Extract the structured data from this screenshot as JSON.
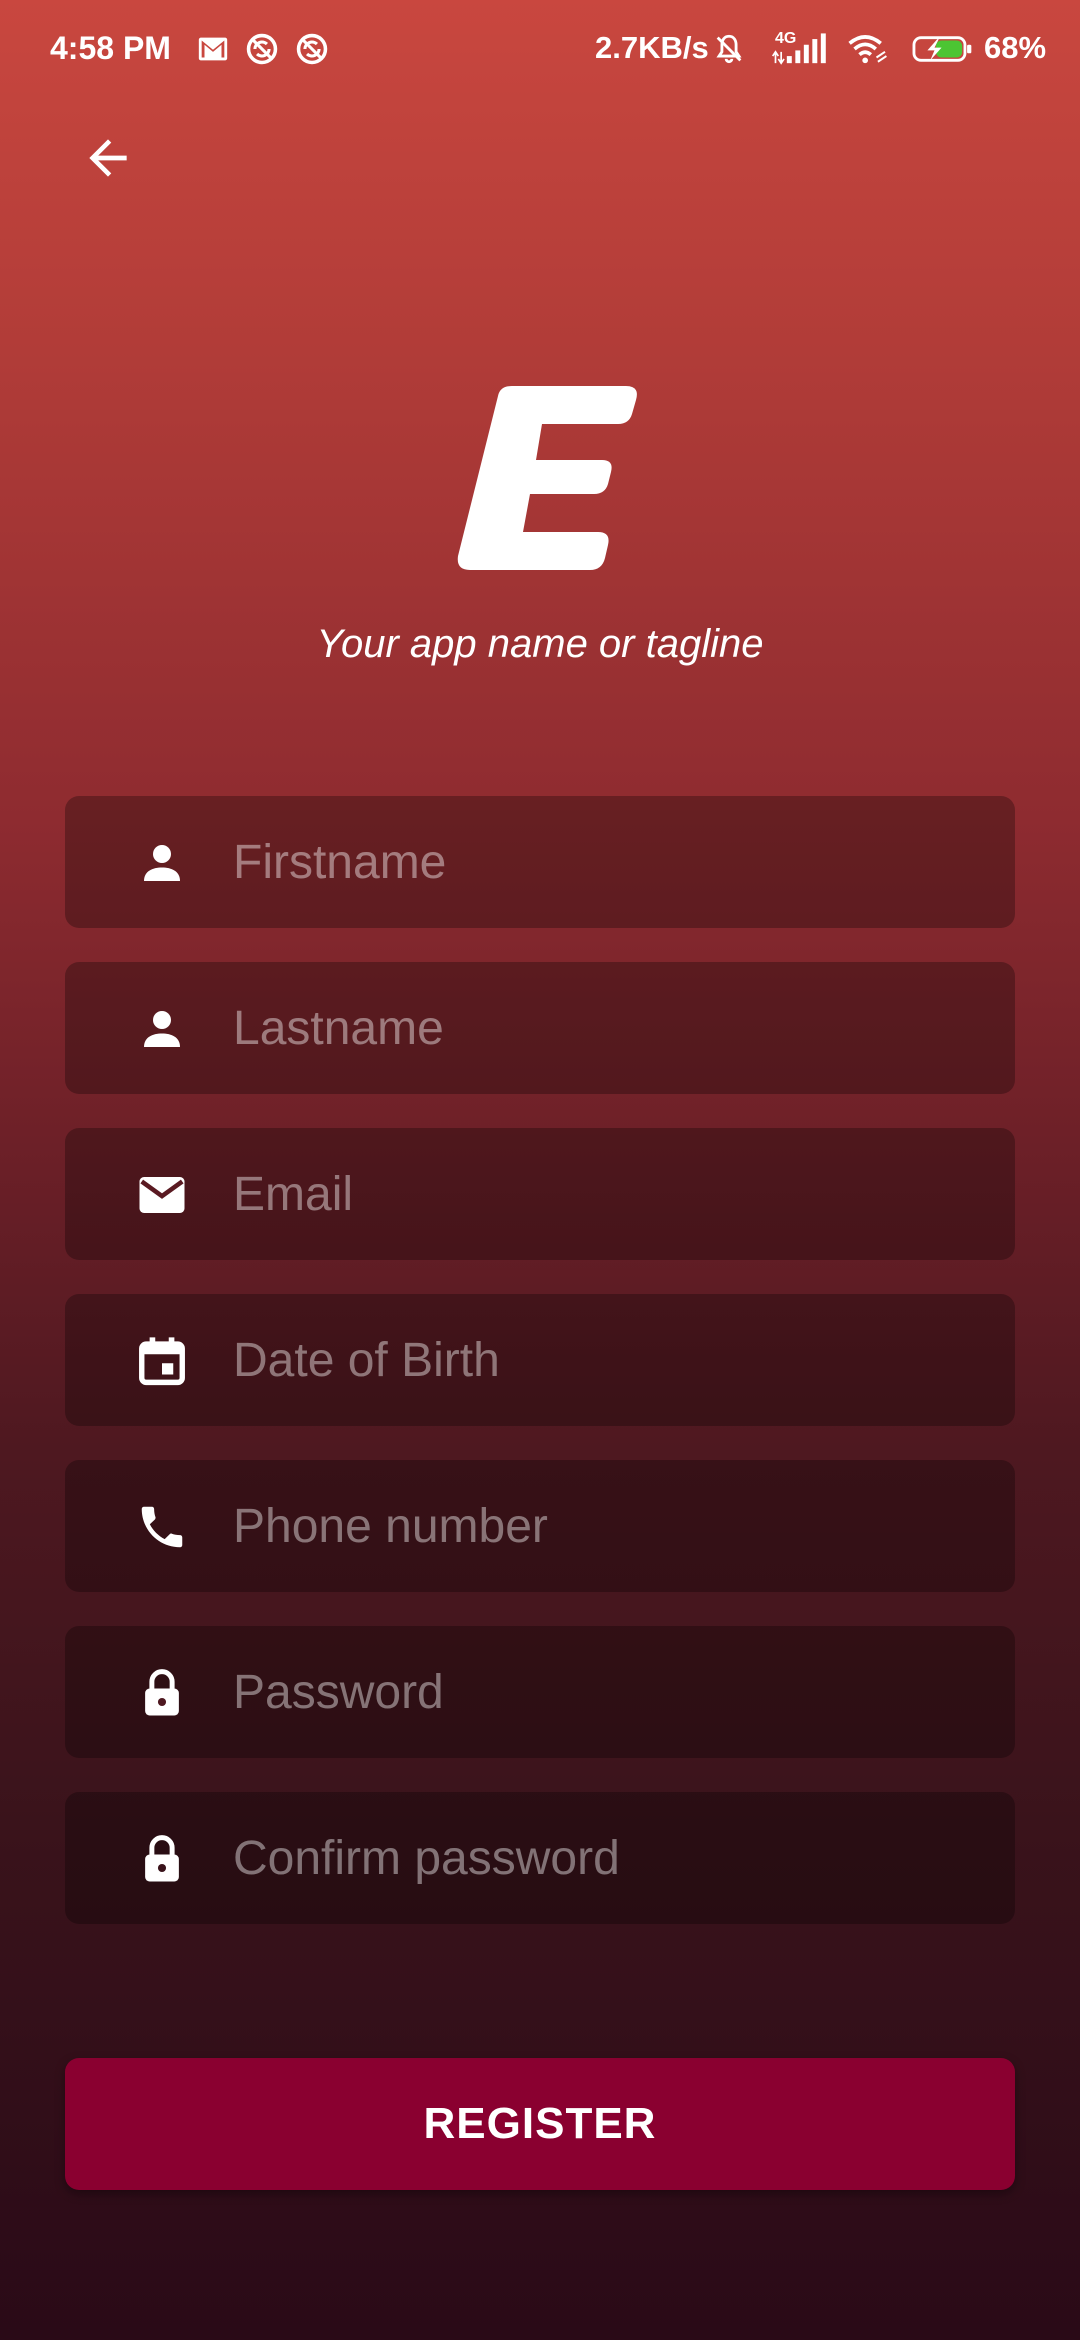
{
  "status_bar": {
    "time": "4:58 PM",
    "net_speed": "2.7KB/s",
    "network_type": "4G",
    "battery": "68%",
    "icons": [
      "gmail-icon",
      "sync-icon",
      "sync-icon",
      "mute-icon",
      "signal-icon",
      "wifi-icon",
      "battery-charging-icon"
    ]
  },
  "header": {
    "back_icon": "arrow-left-icon"
  },
  "branding": {
    "logo_letter": "E",
    "tagline": "Your app name or tagline"
  },
  "form": {
    "fields": [
      {
        "icon": "person-icon",
        "placeholder": "Firstname",
        "value": ""
      },
      {
        "icon": "person-icon",
        "placeholder": "Lastname",
        "value": ""
      },
      {
        "icon": "mail-icon",
        "placeholder": "Email",
        "value": ""
      },
      {
        "icon": "calendar-icon",
        "placeholder": "Date of Birth",
        "value": ""
      },
      {
        "icon": "phone-icon",
        "placeholder": "Phone number",
        "value": ""
      },
      {
        "icon": "lock-icon",
        "placeholder": "Password",
        "value": ""
      },
      {
        "icon": "lock-icon",
        "placeholder": "Confirm password",
        "value": ""
      }
    ],
    "submit_label": "REGISTER"
  },
  "colors": {
    "gradient_top": "#c9473f",
    "gradient_bottom": "#2a0a17",
    "field_bg": "rgba(0,0,0,0.28)",
    "button_bg": "#8a0030",
    "text": "#ffffff"
  }
}
